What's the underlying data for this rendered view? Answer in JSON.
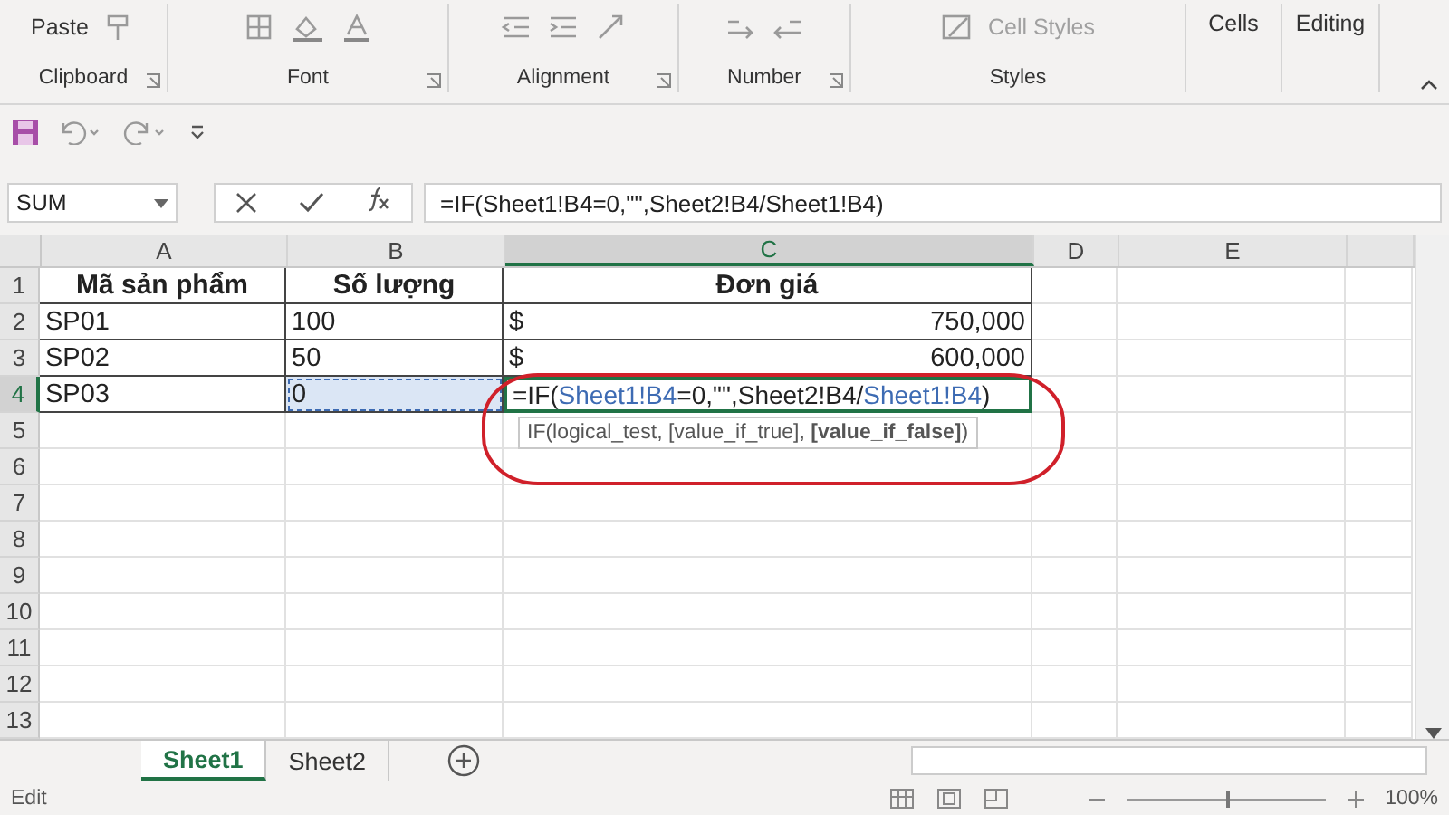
{
  "ribbon": {
    "groups": [
      {
        "label": "Clipboard",
        "launcher": true,
        "kind": "clipboard",
        "button": "Paste"
      },
      {
        "label": "Font",
        "launcher": true,
        "kind": "font"
      },
      {
        "label": "Alignment",
        "launcher": true,
        "kind": "alignment"
      },
      {
        "label": "Number",
        "launcher": true,
        "kind": "number"
      },
      {
        "label": "Styles",
        "launcher": false,
        "kind": "styles",
        "button": "Cell Styles"
      },
      {
        "launcher": false,
        "kind": "big",
        "button": "Cells"
      },
      {
        "launcher": false,
        "kind": "big",
        "button": "Editing"
      }
    ]
  },
  "formula_bar": {
    "name_box": "SUM",
    "formula": "=IF(Sheet1!B4=0,\"\",Sheet2!B4/Sheet1!B4)"
  },
  "columns": [
    {
      "label": "A",
      "selected": false
    },
    {
      "label": "B",
      "selected": false
    },
    {
      "label": "C",
      "selected": true
    },
    {
      "label": "D",
      "selected": false
    },
    {
      "label": "E",
      "selected": false
    }
  ],
  "rows": [
    {
      "label": "1",
      "selected": false,
      "cells": [
        {
          "kind": "header",
          "text": "Mã sản phẩm"
        },
        {
          "kind": "header",
          "text": "Số lượng"
        },
        {
          "kind": "header",
          "text": "Đơn giá"
        }
      ]
    },
    {
      "label": "2",
      "selected": false,
      "cells": [
        {
          "kind": "text",
          "text": "SP01"
        },
        {
          "kind": "text",
          "text": "100"
        },
        {
          "kind": "currency",
          "currency": "$",
          "text": "750,000"
        }
      ]
    },
    {
      "label": "3",
      "selected": false,
      "cells": [
        {
          "kind": "text",
          "text": "SP02"
        },
        {
          "kind": "text",
          "text": "50"
        },
        {
          "kind": "currency",
          "currency": "$",
          "text": "600,000"
        }
      ]
    },
    {
      "label": "4",
      "selected": true,
      "cells": [
        {
          "kind": "text",
          "text": "SP03"
        },
        {
          "kind": "text",
          "text": "0",
          "highlighted": true
        },
        {
          "kind": "formula",
          "editing": true,
          "segments": [
            {
              "text": "=IF(",
              "color": "#222222"
            },
            {
              "text": "Sheet1!B4",
              "color": "#3d6bb3"
            },
            {
              "text": "=0,\"\",Sheet2!B4/",
              "color": "#222222"
            },
            {
              "text": "Sheet1!B4",
              "color": "#3d6bb3"
            },
            {
              "text": ")",
              "color": "#222222"
            }
          ],
          "tooltip": "IF(logical_test, [value_if_true], **[value_if_false]**)"
        }
      ]
    },
    {
      "label": "5",
      "selected": false,
      "cells": []
    },
    {
      "label": "6",
      "selected": false,
      "cells": []
    },
    {
      "label": "7",
      "selected": false,
      "cells": []
    },
    {
      "label": "8",
      "selected": false,
      "cells": []
    },
    {
      "label": "9",
      "selected": false,
      "cells": []
    },
    {
      "label": "10",
      "selected": false,
      "cells": []
    },
    {
      "label": "11",
      "selected": false,
      "cells": []
    },
    {
      "label": "12",
      "selected": false,
      "cells": []
    },
    {
      "label": "13",
      "selected": false,
      "cells": []
    }
  ],
  "sheet_tabs": [
    {
      "label": "Sheet1",
      "selected": true
    },
    {
      "label": "Sheet2",
      "selected": false
    }
  ],
  "status_bar": {
    "mode": "Edit",
    "zoom_slider": {
      "level": 0.5
    },
    "zoom": "100%"
  }
}
